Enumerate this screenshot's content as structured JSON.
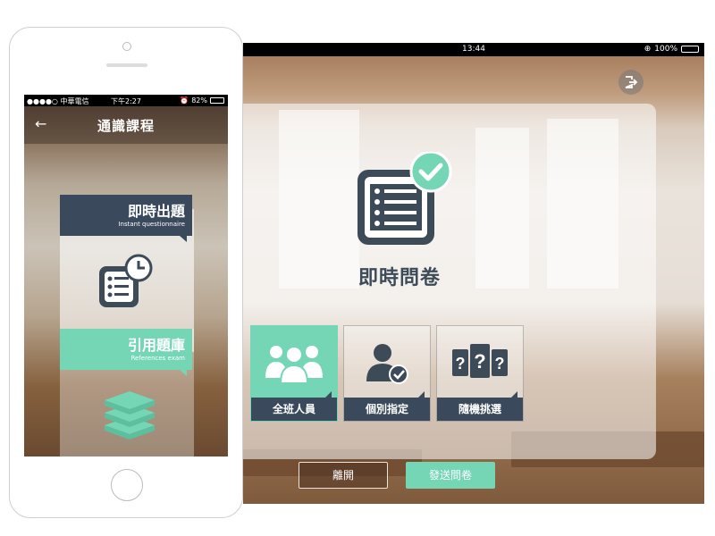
{
  "colors": {
    "accent_teal": "#74d6b5",
    "navy": "#3a4a5c",
    "title_gray": "#3d4a58"
  },
  "phone": {
    "status_bar": {
      "carrier": "●●●●○ 中華電信",
      "time": "下午2:27",
      "battery": "82%"
    },
    "header": {
      "back_icon": "back-arrow-icon",
      "title": "通識課程"
    },
    "cards": [
      {
        "title": "即時出題",
        "subtitle": "Instant questionnaire",
        "icon": "questionnaire-clock-icon",
        "color": "#3a4a5c"
      },
      {
        "title": "引用題庫",
        "subtitle": "References exam",
        "icon": "books-stack-icon",
        "color": "#74d6b5"
      }
    ]
  },
  "tablet": {
    "status_bar": {
      "time": "13:44",
      "battery": "100%"
    },
    "exit_icon": "exit-icon",
    "main": {
      "title": "即時問卷",
      "icon": "checklist-check-icon"
    },
    "options": [
      {
        "label": "全班人員",
        "icon": "group-icon",
        "selected": true
      },
      {
        "label": "個別指定",
        "icon": "person-check-icon",
        "selected": false
      },
      {
        "label": "隨機挑選",
        "icon": "random-question-cards-icon",
        "selected": false
      }
    ],
    "buttons": {
      "leave": "離開",
      "send": "發送問卷"
    }
  }
}
